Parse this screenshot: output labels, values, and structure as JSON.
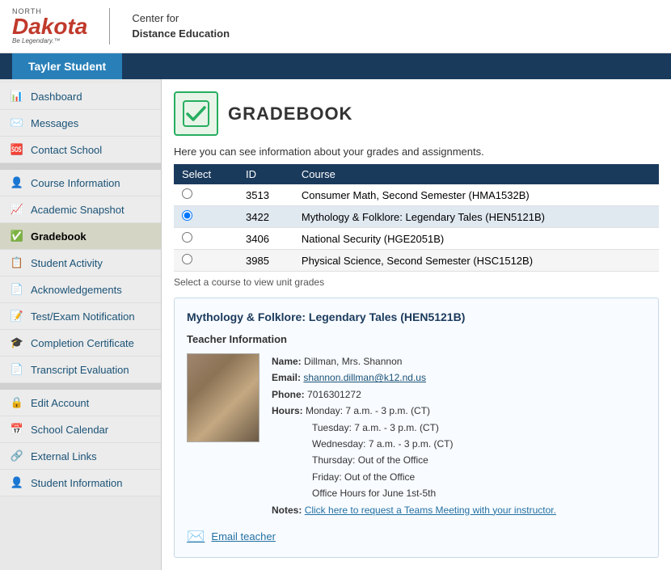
{
  "header": {
    "logo_north": "NORTH",
    "logo_dakota": "Dakota",
    "logo_legendary": "Be Legendary.™",
    "cde_line1": "Center for",
    "cde_line2": "Distance Education"
  },
  "navbar": {
    "user_name": "Tayler Student"
  },
  "sidebar": {
    "items": [
      {
        "id": "dashboard",
        "label": "Dashboard",
        "icon": "📊",
        "active": false
      },
      {
        "id": "messages",
        "label": "Messages",
        "icon": "✉️",
        "active": false
      },
      {
        "id": "contact-school",
        "label": "Contact School",
        "icon": "🆘",
        "active": false
      },
      {
        "id": "course-information",
        "label": "Course Information",
        "icon": "👤",
        "active": false
      },
      {
        "id": "academic-snapshot",
        "label": "Academic Snapshot",
        "icon": "📈",
        "active": false
      },
      {
        "id": "gradebook",
        "label": "Gradebook",
        "icon": "✅",
        "active": true
      },
      {
        "id": "student-activity",
        "label": "Student Activity",
        "icon": "📋",
        "active": false
      },
      {
        "id": "acknowledgements",
        "label": "Acknowledgements",
        "icon": "📄",
        "active": false
      },
      {
        "id": "test-exam",
        "label": "Test/Exam Notification",
        "icon": "📝",
        "active": false
      },
      {
        "id": "completion-cert",
        "label": "Completion Certificate",
        "icon": "🎓",
        "active": false
      },
      {
        "id": "transcript",
        "label": "Transcript Evaluation",
        "icon": "📄",
        "active": false
      },
      {
        "id": "edit-account",
        "label": "Edit Account",
        "icon": "🔒",
        "active": false
      },
      {
        "id": "school-calendar",
        "label": "School Calendar",
        "icon": "📅",
        "active": false
      },
      {
        "id": "external-links",
        "label": "External Links",
        "icon": "🔗",
        "active": false
      },
      {
        "id": "student-info",
        "label": "Student Information",
        "icon": "👤",
        "active": false
      }
    ]
  },
  "gradebook": {
    "page_title": "Gradebook",
    "intro_text": "Here you can see information about your grades and assignments.",
    "table": {
      "headers": [
        "Select",
        "ID",
        "Course"
      ],
      "rows": [
        {
          "id": "3513",
          "course": "Consumer Math, Second Semester (HMA1532B)",
          "selected": false
        },
        {
          "id": "3422",
          "course": "Mythology & Folklore: Legendary Tales (HEN5121B)",
          "selected": true
        },
        {
          "id": "3406",
          "course": "National Security (HGE2051B)",
          "selected": false
        },
        {
          "id": "3985",
          "course": "Physical Science, Second Semester (HSC1512B)",
          "selected": false
        }
      ]
    },
    "select_hint": "Select a course to view unit grades",
    "selected_course_title": "Mythology & Folklore: Legendary Tales (HEN5121B)",
    "teacher_section": "Teacher Information",
    "teacher": {
      "name_label": "Name:",
      "name_value": "Dillman, Mrs. Shannon",
      "email_label": "Email:",
      "email_value": "shannon.dillman@k12.nd.us",
      "phone_label": "Phone:",
      "phone_value": "7016301272",
      "hours_label": "Hours:",
      "hours_lines": [
        "Monday: 7 a.m. - 3 p.m. (CT)",
        "Tuesday: 7 a.m. - 3 p.m. (CT)",
        "Wednesday: 7 a.m. - 3 p.m. (CT)",
        "Thursday: Out of the Office",
        "Friday: Out of the Office",
        "Office Hours for June 1st-5th"
      ],
      "notes_label": "Notes:",
      "notes_link_text": "Click here to request a Teams Meeting with your instructor.",
      "email_teacher_label": "Email teacher"
    }
  }
}
